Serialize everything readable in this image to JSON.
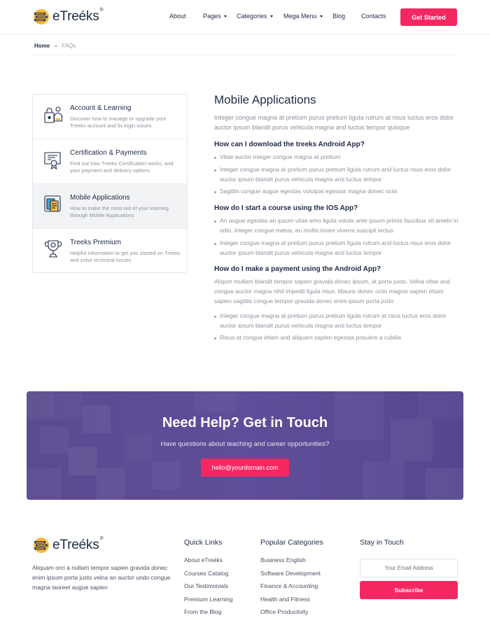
{
  "brand": {
    "name": "eTreéks",
    "reg": "®"
  },
  "nav": {
    "items": [
      {
        "label": "About",
        "has_caret": false
      },
      {
        "label": "Pages",
        "has_caret": true
      },
      {
        "label": "Categories",
        "has_caret": true
      },
      {
        "label": "Mega Menu",
        "has_caret": true
      },
      {
        "label": "Blog",
        "has_caret": false
      },
      {
        "label": "Contacts",
        "has_caret": false
      }
    ],
    "cta": "Get Started"
  },
  "breadcrumb": {
    "home": "Home",
    "separator": "»",
    "current": "FAQs"
  },
  "sidebar": {
    "items": [
      {
        "title": "Account & Learning",
        "desc": "Discover how to manage or upgrade your Treeks account and fix login issues",
        "icon": "account-learning-icon",
        "active": false
      },
      {
        "title": "Certification & Payments",
        "desc": "Find out how Treeks Certification works, and your payment and delivery options",
        "icon": "certificate-icon",
        "active": false
      },
      {
        "title": "Mobile Applications",
        "desc": "How to make the most out of your learning through Mobile Applications",
        "icon": "mobile-app-icon",
        "active": true
      },
      {
        "title": "Treeks Premium",
        "desc": "Helpful information to get you started on Treeks and solve technical issues",
        "icon": "trophy-icon",
        "active": false
      }
    ]
  },
  "main": {
    "title": "Mobile Applications",
    "intro": "Integer congue magna at pretium purus pretium ligula rutrum at risus luctus eros dolor auctor ipsum blandit purus vehicula magna and luctus tempor quisque",
    "questions": [
      {
        "title": "How can I download the treeks Android App?",
        "paragraph": "",
        "bullets": [
          "Vitae auctor integer congue magna at pretium",
          "Integer congue magna at pretium purus pretium ligula rutrum and luctus risus eros dolor auctor ipsum blandit purus vehicula magna and luctus tempor",
          "Sagittis congue augue egestas volutpat egestas magna donec ociis"
        ]
      },
      {
        "title": "How do I start a course using the IOS App?",
        "paragraph": "",
        "bullets": [
          "An augue egestas an ipsum vitae emo ligula volute ante ipsum primis faucibus sit ametn in odio. Integer congue metus, eu mollis lorem viverra suscipit lectus",
          "Integer congue magna at pretium purus pretium ligula rutrum and luctus risus eros dolor auctor ipsum blandit purus vehicula magna and luctus tempor"
        ]
      },
      {
        "title": "How do I make a payment using the Android App?",
        "paragraph": "Aliqum mullam blandit tempor sapien gravida donec ipsum, at porta justo. Velna vitae and congue auctor magna nihil impedit ligula risus. Mauris donec ociis magnis sapien etiam sapien sagittis congue tempor gravida donec enim ipsum porta justo",
        "bullets": [
          "Integer congue magna at pretium purus pretium ligula rutrum at risus luctus eros dolor auctor ipsum blandit purus vehicula magna and luctus tempor",
          "Risus at congue etiam and aliquam sapien egestas posuere a cubilia"
        ]
      }
    ]
  },
  "banner": {
    "title": "Need Help? Get in Touch",
    "subtitle": "Have questions about teaching and career opportunities?",
    "email": "hello@yourdomain.com"
  },
  "footer": {
    "about": "Aliquam orci a nullam tempor sapien gravida donec enim ipsum porta justo velna an auctor undo congue magna laoreet augue sapien",
    "quick_links": {
      "title": "Quick Links",
      "links": [
        "About eTreéks",
        "Courses Catalog",
        "Our Testimonials",
        "Premium Learning",
        "From the Blog"
      ]
    },
    "popular_categories": {
      "title": "Popular Categories",
      "links": [
        "Business English",
        "Software Development",
        "Finance & Accounting",
        "Health and Fitness",
        "Office Productivity"
      ]
    },
    "stay_in_touch": {
      "title": "Stay in Touch",
      "email_placeholder": "Your Email Address",
      "subscribe": "Subscribe"
    }
  },
  "colors": {
    "accent": "#f32861",
    "text_dark": "#1f2a44",
    "text_muted": "#8b919c",
    "banner": "#5b4a8f"
  }
}
